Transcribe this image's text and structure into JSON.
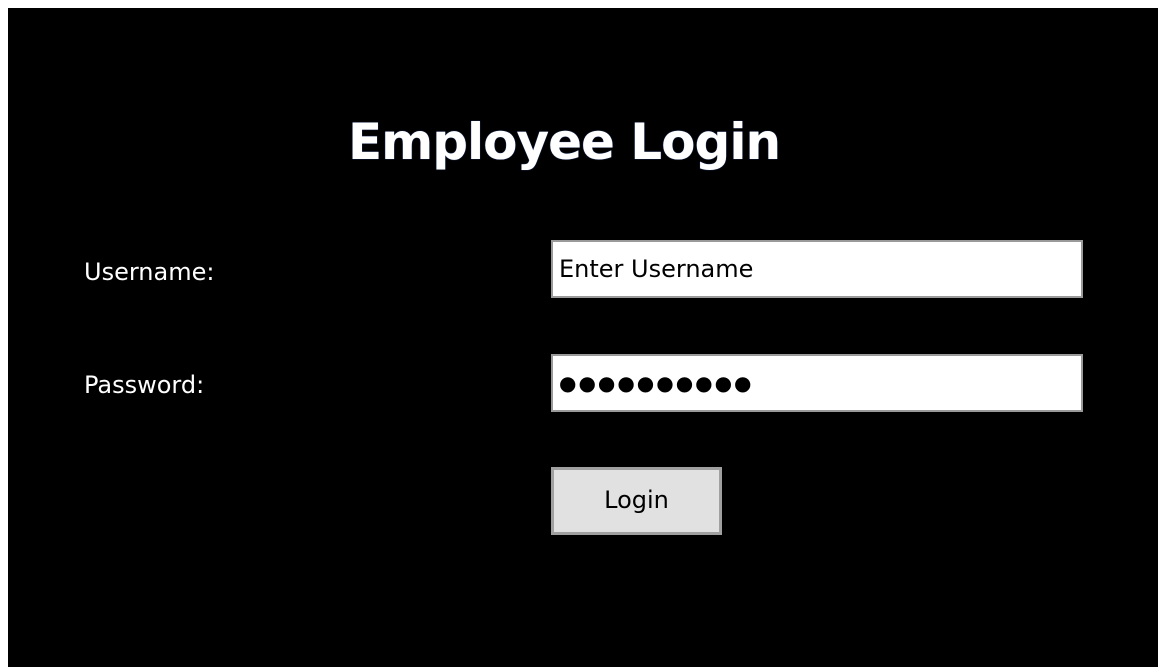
{
  "login": {
    "title": "Employee Login",
    "username_label": "Username:",
    "username_value": "Enter Username",
    "password_label": "Password:",
    "password_value": "●●●●●●●●●●",
    "login_button": "Login"
  },
  "colors": {
    "background": "#000000",
    "text": "#ffffff",
    "field_background": "#ffffff",
    "button_background": "#e1e1e1"
  }
}
